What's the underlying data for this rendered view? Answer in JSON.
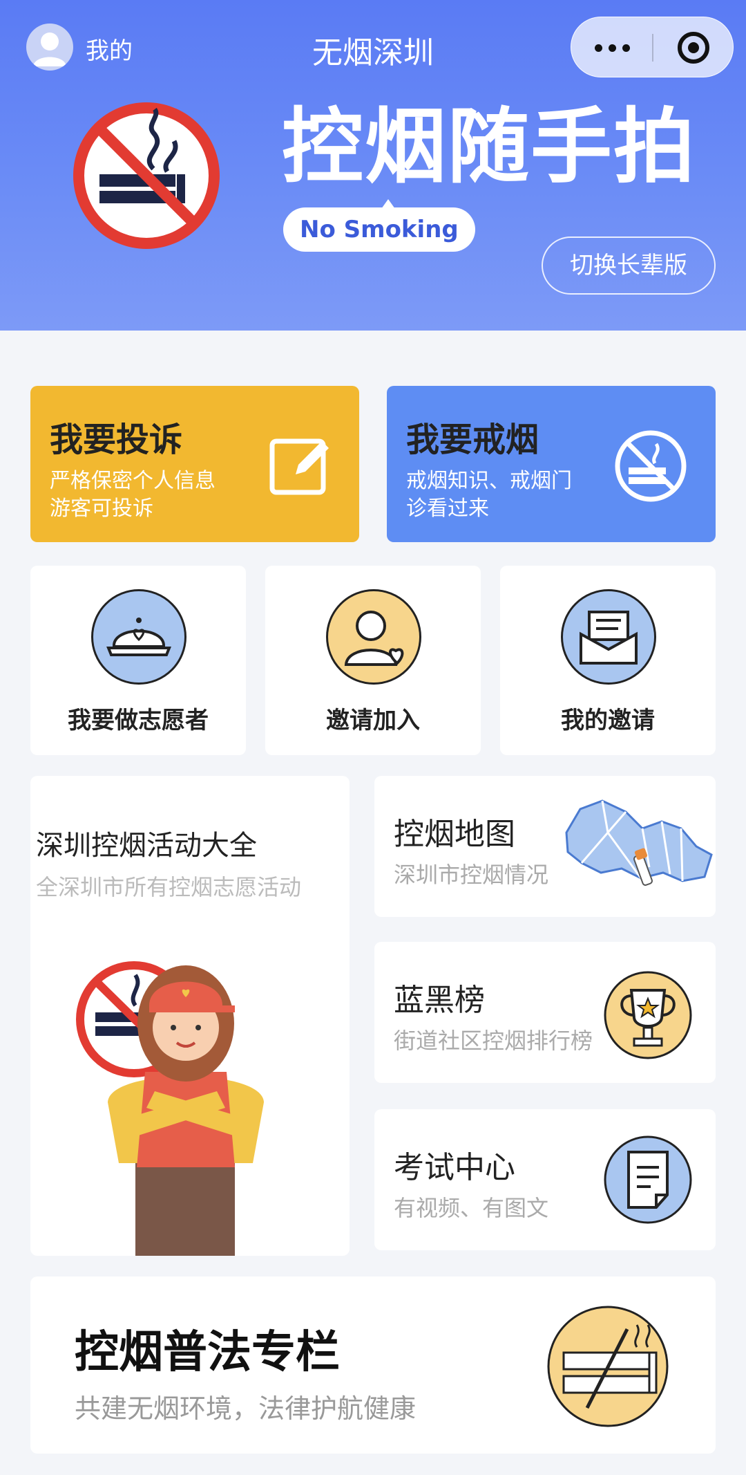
{
  "nav": {
    "me_label": "我的",
    "app_title": "无烟深圳",
    "more_icon": "more-dots-icon",
    "close_icon": "target-close-icon"
  },
  "banner": {
    "title_part1": "控",
    "title_highlight": "烟",
    "title_part2": "随手拍",
    "pill_text": "No Smoking",
    "elder_mode_label": "切换长辈版",
    "background_color": "#5a7bf4"
  },
  "cards": {
    "complain": {
      "title": "我要投诉",
      "line1": "严格保密个人信息",
      "line2": "游客可投诉",
      "color": "#f2b830",
      "icon": "edit-icon"
    },
    "quit": {
      "title": "我要戒烟",
      "line1": "戒烟知识、戒烟门",
      "line2": "诊看过来",
      "color": "#5e8df3",
      "icon": "no-smoking-icon"
    },
    "volunteer": {
      "label": "我要做志愿者",
      "icon": "volunteer-cap-icon"
    },
    "invite": {
      "label": "邀请加入",
      "icon": "user-heart-icon"
    },
    "my_invites": {
      "label": "我的邀请",
      "icon": "envelope-icon"
    },
    "activities": {
      "title": "深圳控烟活动大全",
      "subtitle": "全深圳市所有控烟志愿活动"
    },
    "map": {
      "title": "控烟地图",
      "subtitle": "深圳市控烟情况",
      "icon": "shenzhen-map-icon"
    },
    "ranking": {
      "title": "蓝黑榜",
      "subtitle": "街道社区控烟排行榜",
      "icon": "trophy-icon"
    },
    "exam": {
      "title": "考试中心",
      "subtitle": "有视频、有图文",
      "icon": "document-icon"
    },
    "law": {
      "title": "控烟普法专栏",
      "subtitle": "共建无烟环境，法律护航健康",
      "icon": "no-smoking-cigarette-icon"
    }
  }
}
